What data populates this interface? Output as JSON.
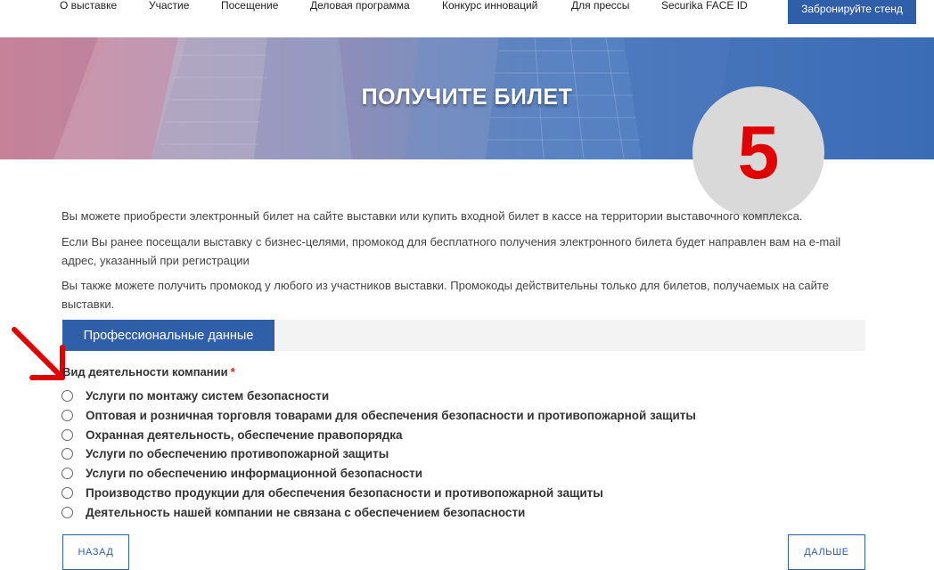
{
  "nav": {
    "items": [
      "О выставке",
      "Участие",
      "Посещение",
      "Деловая программа",
      "Конкурс инноваций",
      "Для прессы",
      "Securika FACE ID"
    ],
    "cta_label": "Забронируйте стенд"
  },
  "banner": {
    "title": "ПОЛУЧИТЕ БИЛЕТ"
  },
  "step_badge": {
    "number": "5",
    "color": "#e00000"
  },
  "intro": {
    "p1": "Вы можете приобрести электронный билет на сайте выставки или купить входной билет в кассе на территории выставочного комплекса.",
    "p2": "Если Вы ранее посещали выставку с бизнес-целями, промокод для бесплатного получения электронного билета будет направлен вам на e-mail адрес, указанный при регистрации",
    "p3": "Вы также можете получить промокод у любого из участников выставки. Промокоды действительны только для билетов, получаемых на сайте выставки."
  },
  "form": {
    "section_title": "Профессиональные данные",
    "field_label": "Вид деятельности компании",
    "required_mark": "*",
    "options": [
      "Услуги по монтажу систем безопасности",
      "Оптовая и розничная торговля товарами для обеспечения безопасности и противопожарной защиты",
      "Охранная деятельность, обеспечение правопорядка",
      "Услуги по обеспечению противопожарной защиты",
      "Услуги по обеспечению информационной безопасности",
      "Производство продукции для обеспечения безопасности и противопожарной защиты",
      "Деятельность нашей компании не связана с обеспечением безопасности"
    ],
    "back_label": "НАЗАД",
    "next_label": "ДАЛЬШЕ"
  },
  "annotation": {
    "arrow_icon": "arrow-down-right-icon",
    "color": "#e00000"
  },
  "colors": {
    "accent": "#2f5fa8",
    "required": "#d9251c"
  }
}
